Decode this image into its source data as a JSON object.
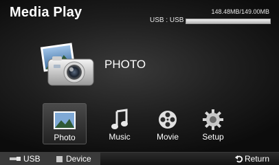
{
  "header": {
    "title": "Media Play",
    "usb_label": "USB : USB",
    "usb_size": "148.48MB/149.00MB",
    "usb_used_fraction": 0.9965
  },
  "hero": {
    "label": "PHOTO",
    "icon": "photo-camera-icon"
  },
  "menu": {
    "items": [
      {
        "label": "Photo",
        "icon": "photo-icon",
        "selected": true
      },
      {
        "label": "Music",
        "icon": "music-note-icon",
        "selected": false
      },
      {
        "label": "Movie",
        "icon": "film-reel-icon",
        "selected": false
      },
      {
        "label": "Setup",
        "icon": "gear-icon",
        "selected": false
      }
    ]
  },
  "footer": {
    "usb": "USB",
    "device": "Device",
    "return": "Return"
  },
  "colors": {
    "background": "#1e1e1e",
    "text": "#ffffff",
    "selected_tile": "#3a3a3a"
  }
}
